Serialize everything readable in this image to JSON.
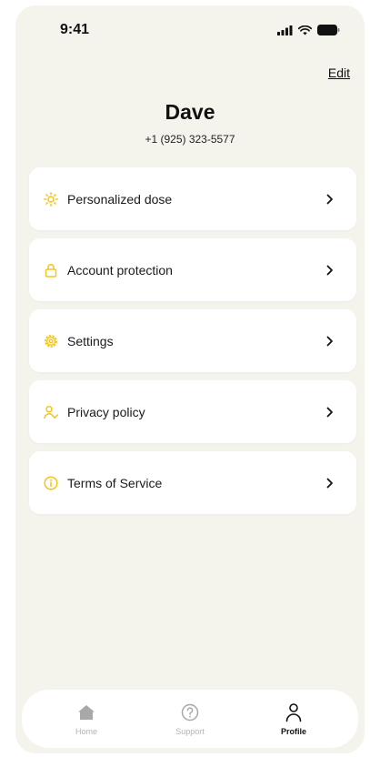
{
  "status_bar": {
    "time": "9:41"
  },
  "header": {
    "edit_label": "Edit"
  },
  "profile": {
    "name": "Dave",
    "phone": "+1 (925) 323-5577"
  },
  "menu": {
    "items": [
      {
        "label": "Personalized dose",
        "icon": "sun-icon"
      },
      {
        "label": "Account protection",
        "icon": "lock-icon"
      },
      {
        "label": "Settings",
        "icon": "gear-icon"
      },
      {
        "label": "Privacy policy",
        "icon": "user-check-icon"
      },
      {
        "label": "Terms of Service",
        "icon": "info-icon"
      }
    ]
  },
  "tab_bar": {
    "tabs": [
      {
        "label": "Home",
        "icon": "home-icon",
        "active": false
      },
      {
        "label": "Support",
        "icon": "question-circle-icon",
        "active": false
      },
      {
        "label": "Profile",
        "icon": "person-icon",
        "active": true
      }
    ]
  },
  "colors": {
    "background": "#f4f3ec",
    "card": "#ffffff",
    "accent_yellow": "#f5c518",
    "text": "#111111",
    "inactive_tab": "#b3b3b3"
  }
}
